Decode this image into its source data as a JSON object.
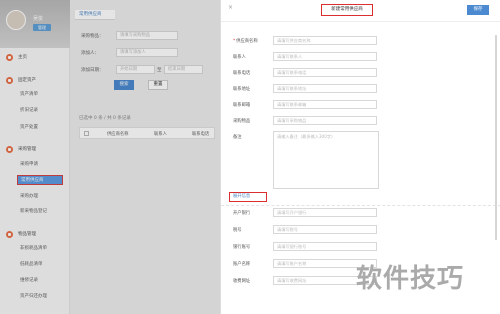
{
  "sidebar": {
    "user_name": "吴俊",
    "user_badge": "管理",
    "items": [
      {
        "label": "主页",
        "type": "menu"
      },
      {
        "label": "固定资产",
        "type": "menu"
      },
      {
        "label": "资产清单",
        "type": "sub"
      },
      {
        "label": "折旧记录",
        "type": "sub"
      },
      {
        "label": "资产处置",
        "type": "sub"
      },
      {
        "label": "采购管理",
        "type": "menu"
      },
      {
        "label": "采购申请",
        "type": "sub"
      },
      {
        "label": "常用供应商",
        "type": "sub",
        "active": true
      },
      {
        "label": "采购办理",
        "type": "sub"
      },
      {
        "label": "新采物品登记",
        "type": "sub"
      },
      {
        "label": "物品管理",
        "type": "menu"
      },
      {
        "label": "非损耗品清单",
        "type": "sub"
      },
      {
        "label": "低耗品清单",
        "type": "sub"
      },
      {
        "label": "维修记录",
        "type": "sub"
      },
      {
        "label": "资产归还办理",
        "type": "sub"
      }
    ]
  },
  "main": {
    "tab": "常用供应商",
    "filters": [
      {
        "label": "采购物品：",
        "placeholder": "请填写采购物品"
      },
      {
        "label": "添加人：",
        "placeholder": "请填写添加人"
      },
      {
        "label": "添加日期：",
        "placeholder": "开始日期",
        "end_placeholder": "结束日期",
        "sep": "至"
      }
    ],
    "search_button": "搜索",
    "reset_button": "重置",
    "summary": "已选中 0 条 / 共 0 条记录",
    "columns": [
      "供应商名称",
      "联系人",
      "联系电话"
    ]
  },
  "drawer": {
    "title": "新建常用供应商",
    "save_button": "保存",
    "fields": [
      {
        "label": "供应商名称",
        "required": true,
        "placeholder": "请填写供应商名称"
      },
      {
        "label": "联系人",
        "placeholder": "请填写联系人"
      },
      {
        "label": "联系电话",
        "placeholder": "请填写联系电话"
      },
      {
        "label": "联系地址",
        "placeholder": "请填写联系地址"
      },
      {
        "label": "联系邮箱",
        "placeholder": "请填写联系邮箱"
      },
      {
        "label": "采购物品",
        "placeholder": "请填写采购物品"
      },
      {
        "label": "备注",
        "placeholder": "请输入备注（最多输入300字）"
      }
    ],
    "more_button": "展开信息",
    "extra_fields": [
      {
        "label": "开户银行",
        "placeholder": "请填写开户银行"
      },
      {
        "label": "税号",
        "placeholder": "请填写税号"
      },
      {
        "label": "银行账号",
        "placeholder": "请填写银行账号"
      },
      {
        "label": "账户名称",
        "placeholder": "请填写账户名称"
      },
      {
        "label": "收费网址",
        "placeholder": "请填写收费网址"
      }
    ]
  },
  "watermark": "软件技巧",
  "colors": {
    "accent": "#4b8ad0",
    "active": "#5d9be3",
    "highlight": "#d92f2f",
    "menu_icon": "#e96f46"
  }
}
